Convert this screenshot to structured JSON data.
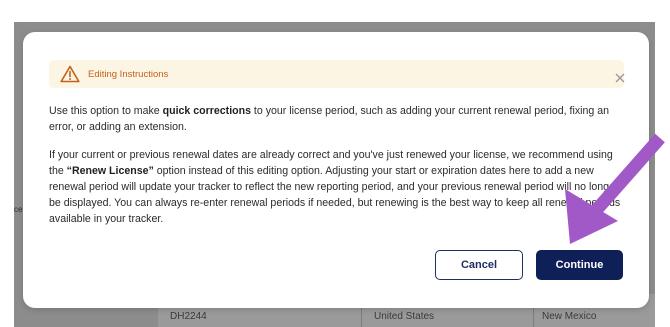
{
  "background": {
    "left_fragment": "ce",
    "table_row": [
      "DH2244",
      "United States",
      "New Mexico"
    ]
  },
  "modal": {
    "banner": {
      "icon": "warning-icon",
      "label": "Editing Instructions",
      "accent_color": "#c1621b",
      "background_color": "#fdf5e3"
    },
    "close_icon": "close-icon",
    "paragraph1": {
      "before": "Use this option to make ",
      "bold": "quick corrections",
      "after": " to your license period, such as adding your current renewal period, fixing an error, or adding an extension."
    },
    "paragraph2": {
      "before": "If your current or previous renewal dates are already correct and you've just renewed your license, we recommend using the ",
      "bold": "“Renew License”",
      "after": " option instead of this editing option. Adjusting your start or expiration dates here to add a new renewal period will update your tracker to reflect the new reporting period, and your previous renewal period will no longer be displayed. You can always re-enter renewal periods if needed, but renewing is the best way to keep all renewal periods available in your tracker."
    },
    "buttons": {
      "cancel": "Cancel",
      "continue": "Continue",
      "primary_color": "#0f1f58"
    }
  },
  "annotation": {
    "arrow_color": "#a259c8"
  }
}
